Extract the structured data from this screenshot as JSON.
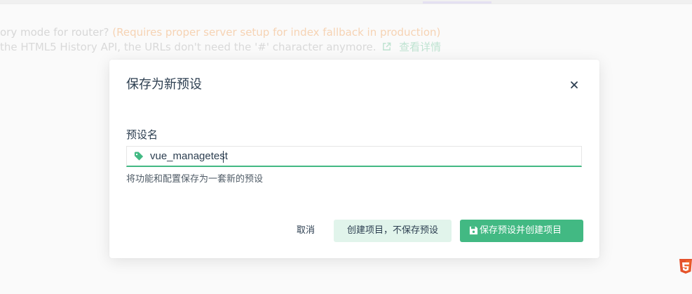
{
  "background": {
    "history_question": "ory mode for router?",
    "history_warning": "(Requires proper server setup for index fallback in production)",
    "history_desc": "the HTML5 History API, the URLs don't need the '#' character anymore.",
    "more_info_link": "查看详情"
  },
  "modal": {
    "title": "保存为新预设",
    "field_label": "预设名",
    "preset_name_value": "vue_managetest",
    "hint": "将功能和配置保存为一套新的预设",
    "cancel_label": "取消",
    "create_without_save_label": "创建项目，不保存预设",
    "save_and_create_label": "保存预设并创建项目"
  },
  "colors": {
    "accent": "#42b983",
    "accent_light": "#e1f4eb",
    "text": "#2c3e50",
    "warning": "#f6d3b4"
  },
  "icons": {
    "close": "close-icon",
    "tag": "tag-icon",
    "save": "save-icon",
    "external_link": "external-link-icon",
    "html5_logo": "html5-logo-icon"
  }
}
